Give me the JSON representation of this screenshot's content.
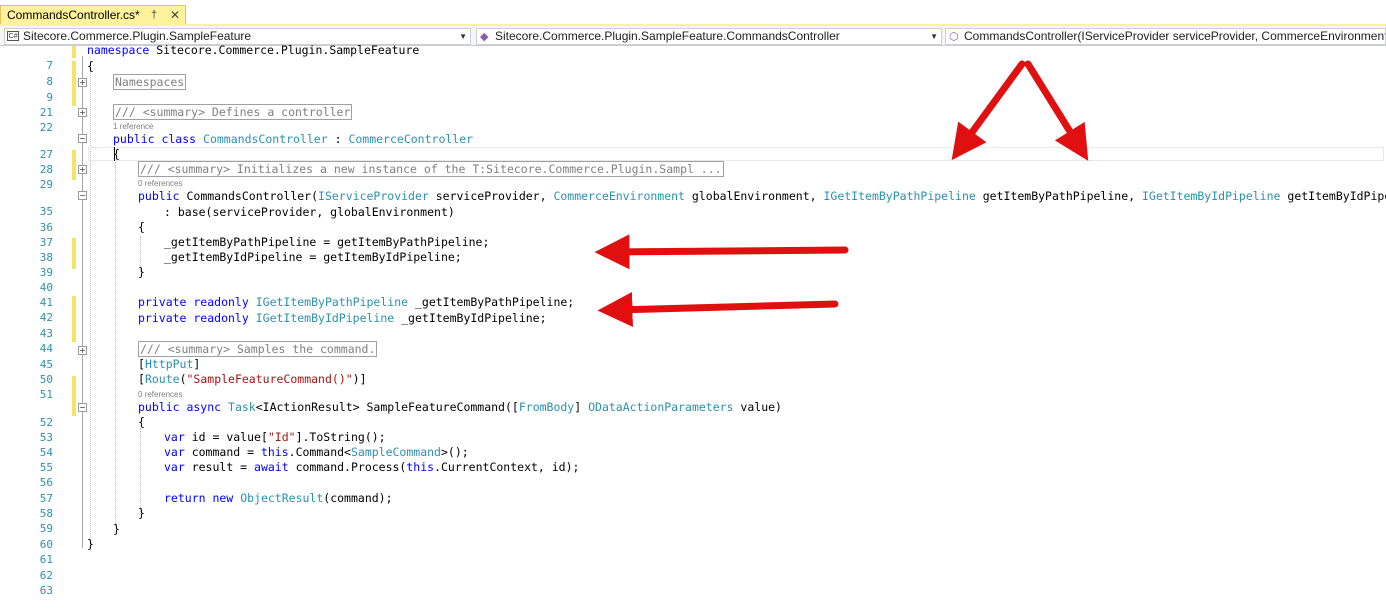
{
  "tab": {
    "title": "CommandsController.cs*",
    "pin": "†",
    "close": "✕"
  },
  "nav": {
    "project": "Sitecore.Commerce.Plugin.SampleFeature",
    "type": "Sitecore.Commerce.Plugin.SampleFeature.CommandsController",
    "member": "CommandsController(IServiceProvider serviceProvider, CommerceEnvironment"
  },
  "refs": {
    "r1": "1 reference",
    "r0a": "0 references",
    "r0b": "0 references"
  },
  "lines": {
    "n7": "7",
    "n8": "8",
    "n9": "9",
    "n21": "21",
    "n22": "22",
    "n27": "27",
    "n28": "28",
    "n29": "29",
    "n35": "35",
    "n36": "36",
    "n37": "37",
    "n38": "38",
    "n39": "39",
    "n40": "40",
    "n41": "41",
    "n42": "42",
    "n43": "43",
    "n44": "44",
    "n45": "45",
    "n50": "50",
    "n51": "51",
    "n52": "52",
    "n53": "53",
    "n54": "54",
    "n55": "55",
    "n56": "56",
    "n57": "57",
    "n58": "58",
    "n59": "59",
    "n60": "60",
    "n61": "61",
    "n62": "62",
    "n63": "63"
  },
  "code": {
    "l7_kw": "namespace",
    "l7_rest": " Sitecore.Commerce.Plugin.SampleFeature",
    "l8": "{",
    "l9_box": "Namespaces",
    "l22_box": "/// <summary> Defines a controller",
    "l27_kw": "public class",
    "l27_name": "CommandsController",
    "l27_sep": " : ",
    "l27_base": "CommerceController",
    "l28": "{",
    "l29_box": "/// <summary> Initializes a new instance of the T:Sitecore.Commerce.Plugin.Sampl ...",
    "l35_kw": "public",
    "l35_a": " CommandsController(",
    "l35_t1": "IServiceProvider",
    "l35_b": " serviceProvider, ",
    "l35_t2": "CommerceEnvironment",
    "l35_c": " globalEnvironment, ",
    "l35_t3": "IGetItemByPathPipeline",
    "l35_d": " getItemByPathPipeline, ",
    "l35_t4": "IGetItemByIdPipeline",
    "l35_e": " getItemByIdPipeline)",
    "l36": ": base(serviceProvider, globalEnvironment)",
    "l37": "{",
    "l38": "_getItemByPathPipeline = getItemByPathPipeline;",
    "l39": "_getItemByIdPipeline = getItemByIdPipeline;",
    "l40": "}",
    "l42_kw": "private readonly",
    "l42_t": "IGetItemByPathPipeline",
    "l42_rest": " _getItemByPathPipeline;",
    "l43_kw": "private readonly",
    "l43_t": "IGetItemByIdPipeline",
    "l43_rest": " _getItemByIdPipeline;",
    "l45_box": "/// <summary> Samples the command.",
    "l50_o": "[",
    "l50_t": "HttpPut",
    "l50_c": "]",
    "l51_o": "[",
    "l51_t": "Route",
    "l51_p": "(",
    "l51_s": "\"SampleFeatureCommand()\"",
    "l51_c": ")]",
    "l52_kw": "public async",
    "l52_t1": "Task",
    "l52_a": "<IActionResult> SampleFeatureCommand([",
    "l52_t2": "FromBody",
    "l52_b": "] ",
    "l52_t3": "ODataActionParameters",
    "l52_c": " value)",
    "l53": "{",
    "l54_kw": "var",
    "l54_a": " id = value[",
    "l54_s": "\"Id\"",
    "l54_b": "].ToString();",
    "l55_kw": "var",
    "l55_a": " command = ",
    "l55_this": "this",
    "l55_b": ".Command<",
    "l55_t": "SampleCommand",
    "l55_c": ">();",
    "l56_kw": "var",
    "l56_a": " result = ",
    "l56_kw2": "await",
    "l56_b": " command.Process(",
    "l56_this": "this",
    "l56_c": ".CurrentContext, id);",
    "l58_kw": "return new",
    "l58_t": "ObjectResult",
    "l58_rest": "(command);",
    "l59": "}",
    "l60": "}",
    "l61": "}"
  },
  "colors": {
    "arrow": "#e01010",
    "keyword": "#0000ff",
    "type": "#2b91af",
    "string": "#a31515",
    "changed": "#f2e36b"
  }
}
